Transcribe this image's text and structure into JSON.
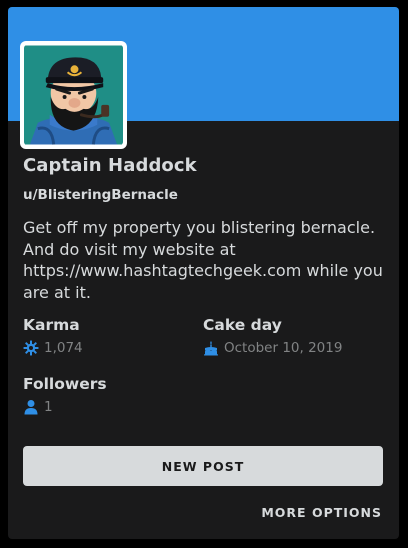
{
  "profile": {
    "display_name": "Captain Haddock",
    "username": "u/BlisteringBernacle",
    "bio": "Get off my property you blistering bernacle. And do visit my website at https://www.hashtagtechgeek.com while you are at it."
  },
  "stats": {
    "karma_label": "Karma",
    "karma_value": "1,074",
    "cake_day_label": "Cake day",
    "cake_day_value": "October 10, 2019",
    "followers_label": "Followers",
    "followers_value": "1"
  },
  "actions": {
    "new_post_label": "NEW POST",
    "more_options_label": "MORE OPTIONS"
  },
  "icons": {
    "karma": "karma-icon",
    "cake": "cake-icon",
    "followers": "person-icon"
  },
  "colors": {
    "banner": "#2F8FE6",
    "card_bg": "#1A1A1B",
    "accent": "#2F8FE6",
    "text": "#D7DADC",
    "muted": "#818384"
  }
}
